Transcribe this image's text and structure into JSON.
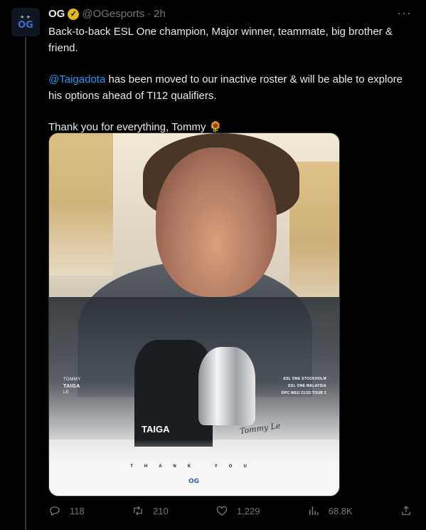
{
  "account": {
    "name": "OG",
    "handle": "@OGesports",
    "time": "2h",
    "avatar_text": "OG"
  },
  "tweet": {
    "line1": "Back-to-back ESL One champion, Major winner, teammate, big brother & friend.",
    "mention": "@Taigadota",
    "line2_rest": " has been moved to our inactive roster & will be able to explore his options ahead of TI12 qualifiers.",
    "line3": "Thank you for everything, Tommy 🌻"
  },
  "media": {
    "name_small": "TOMMY",
    "name_bold": "TAIGA",
    "name_last": "LE",
    "titles": [
      "ESL ONE STOCKHOLM",
      "ESL ONE MALAYSIA",
      "DPC WEU 21/22 TOUR 2"
    ],
    "thank_you": "THANK YOU",
    "shirt_text": "TAIGA",
    "signature": "Tommy Le",
    "logo": "OG"
  },
  "actions": {
    "replies": "118",
    "retweets": "210",
    "likes": "1,229",
    "views": "68.8K"
  },
  "colors": {
    "background": "#000000",
    "text": "#e7e9ea",
    "muted": "#71767b",
    "link": "#1d9bf0",
    "verified": "#e2b719"
  },
  "icons": [
    "more-icon",
    "verified-icon",
    "reply-icon",
    "retweet-icon",
    "like-icon",
    "views-icon",
    "share-icon"
  ]
}
